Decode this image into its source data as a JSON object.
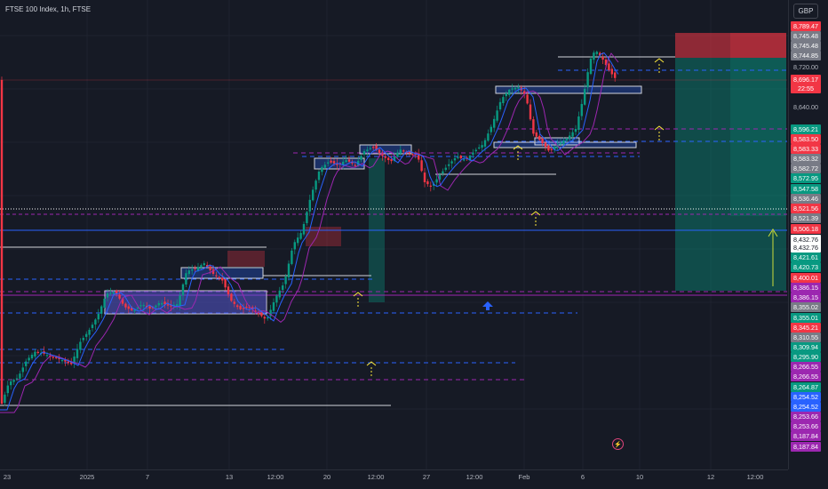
{
  "header": {
    "symbol_title": "FTSE 100 Index, 1h, FTSE",
    "currency_button": "GBP"
  },
  "price_labels": [
    {
      "text": "8,789.47",
      "bg": "#f23645",
      "fg": "#ffffff"
    },
    {
      "text": "8,745.48",
      "bg": "#787b86",
      "fg": "#ffffff"
    },
    {
      "text": "8,745.48",
      "bg": "#787b86",
      "fg": "#ffffff"
    },
    {
      "text": "8,744.85",
      "bg": "#787b86",
      "fg": "#ffffff"
    },
    {
      "text": "8,720.00",
      "bg": "none",
      "fg": "#b2b5be"
    },
    {
      "text": "8,696.17",
      "bg": "#f23645",
      "fg": "#ffffff"
    },
    {
      "text": "22:55",
      "bg": "#f23645",
      "fg": "#ffffff"
    },
    {
      "text": "8,640.00",
      "bg": "none",
      "fg": "#b2b5be"
    },
    {
      "text": "8,596.21",
      "bg": "#089981",
      "fg": "#ffffff"
    },
    {
      "text": "8,583.50",
      "bg": "#f23645",
      "fg": "#ffffff"
    },
    {
      "text": "8,583.33",
      "bg": "#f23645",
      "fg": "#ffffff"
    },
    {
      "text": "8,583.32",
      "bg": "#787b86",
      "fg": "#ffffff"
    },
    {
      "text": "8,582.72",
      "bg": "#787b86",
      "fg": "#ffffff"
    },
    {
      "text": "8,572.95",
      "bg": "#089981",
      "fg": "#ffffff"
    },
    {
      "text": "8,547.58",
      "bg": "#089981",
      "fg": "#ffffff"
    },
    {
      "text": "8,536.46",
      "bg": "#787b86",
      "fg": "#ffffff"
    },
    {
      "text": "8,521.56",
      "bg": "#f23645",
      "fg": "#ffffff"
    },
    {
      "text": "8,521.39",
      "bg": "#787b86",
      "fg": "#ffffff"
    },
    {
      "text": "8,506.18",
      "bg": "#f23645",
      "fg": "#ffffff"
    },
    {
      "text": "8,432.76",
      "bg": "#ffffff",
      "fg": "#131722"
    },
    {
      "text": "8,432.76",
      "bg": "#ffffff",
      "fg": "#131722"
    },
    {
      "text": "8,421.61",
      "bg": "#089981",
      "fg": "#ffffff"
    },
    {
      "text": "8,420.73",
      "bg": "#089981",
      "fg": "#ffffff"
    },
    {
      "text": "8,400.01",
      "bg": "#f23645",
      "fg": "#ffffff"
    },
    {
      "text": "8,386.15",
      "bg": "#9c27b0",
      "fg": "#ffffff"
    },
    {
      "text": "8,386.15",
      "bg": "#9c27b0",
      "fg": "#ffffff"
    },
    {
      "text": "8,355.02",
      "bg": "#787b86",
      "fg": "#ffffff"
    },
    {
      "text": "8,355.01",
      "bg": "#089981",
      "fg": "#ffffff"
    },
    {
      "text": "8,345.21",
      "bg": "#f23645",
      "fg": "#ffffff"
    },
    {
      "text": "8,310.55",
      "bg": "#787b86",
      "fg": "#ffffff"
    },
    {
      "text": "8,309.94",
      "bg": "#089981",
      "fg": "#ffffff"
    },
    {
      "text": "8,295.90",
      "bg": "#089981",
      "fg": "#ffffff"
    },
    {
      "text": "8,266.55",
      "bg": "#9c27b0",
      "fg": "#ffffff"
    },
    {
      "text": "8,266.55",
      "bg": "#9c27b0",
      "fg": "#ffffff"
    },
    {
      "text": "8,264.87",
      "bg": "#089981",
      "fg": "#ffffff"
    },
    {
      "text": "8,254.52",
      "bg": "#2962ff",
      "fg": "#ffffff"
    },
    {
      "text": "8,254.52",
      "bg": "#2962ff",
      "fg": "#ffffff"
    },
    {
      "text": "8,253.66",
      "bg": "#9c27b0",
      "fg": "#ffffff"
    },
    {
      "text": "8,253.66",
      "bg": "#9c27b0",
      "fg": "#ffffff"
    },
    {
      "text": "8,187.84",
      "bg": "#9c27b0",
      "fg": "#ffffff"
    },
    {
      "text": "8,187.84",
      "bg": "#9c27b0",
      "fg": "#ffffff"
    }
  ],
  "time_labels": [
    "23",
    "2025",
    "7",
    "13",
    "12:00",
    "20",
    "12:00",
    "27",
    "12:00",
    "Feb",
    "6",
    "10",
    "12",
    "12:00"
  ],
  "colors": {
    "background": "#161a25",
    "bull": "#089981",
    "bear": "#f23645",
    "accent": "#2962ff"
  }
}
